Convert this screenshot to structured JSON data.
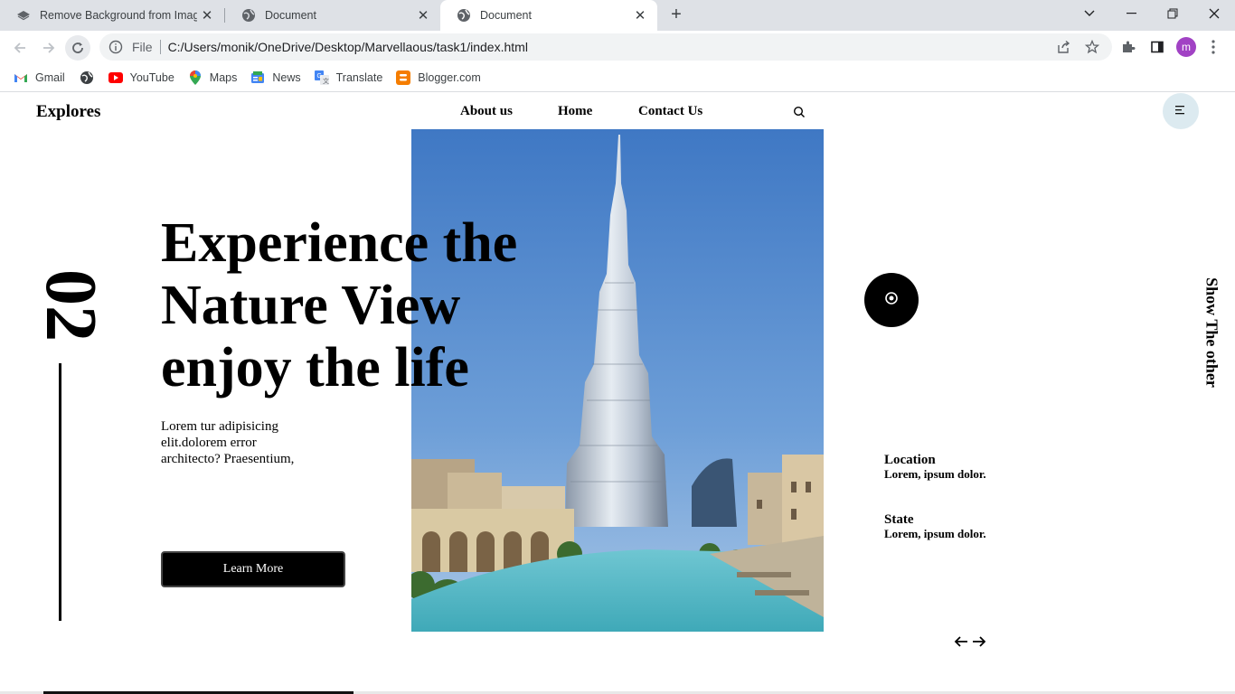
{
  "browser": {
    "tabs": [
      {
        "title": "Remove Background from Image"
      },
      {
        "title": "Document"
      },
      {
        "title": "Document"
      }
    ],
    "omnibox": {
      "scheme": "File",
      "url": "C:/Users/monik/OneDrive/Desktop/Marvellaous/task1/index.html"
    },
    "profile_initial": "m",
    "bookmarks": [
      {
        "label": "Gmail"
      },
      {
        "label": ""
      },
      {
        "label": "YouTube"
      },
      {
        "label": "Maps"
      },
      {
        "label": "News"
      },
      {
        "label": "Translate"
      },
      {
        "label": "Blogger.com"
      }
    ]
  },
  "site": {
    "logo": "Explores",
    "nav": {
      "about": "About us",
      "home": "Home",
      "contact": "Contact Us"
    },
    "counter": "02",
    "headline": {
      "line1": "Experience the",
      "line2": "Nature View",
      "line3": "enjoy the life"
    },
    "description": "Lorem tur adipisicing elit.dolorem error architecto? Praesentium,",
    "cta_label": "Learn More",
    "side_text": "Show The other",
    "info": [
      {
        "label": "Location",
        "value": "Lorem, ipsum dolor."
      },
      {
        "label": "State",
        "value": "Lorem, ipsum dolor."
      }
    ],
    "icons": {
      "search": "search-icon",
      "menu": "menu-icon",
      "eye": "eye-icon",
      "prev": "arrow-left-icon",
      "next": "arrow-right-icon"
    }
  },
  "colors": {
    "accent": "#000000",
    "menu_circle": "#dceaf0",
    "tabbar": "#dee1e6",
    "profile": "#a142c4"
  }
}
